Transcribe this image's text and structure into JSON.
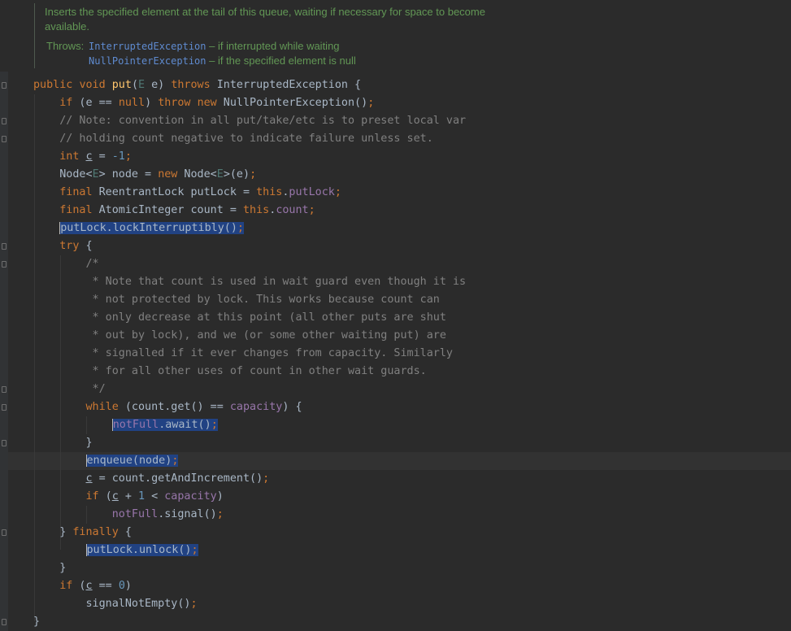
{
  "javadoc": {
    "description": "Inserts the specified element at the tail of this queue, waiting if necessary for space to become available.",
    "throws_label": "Throws:",
    "throws": [
      {
        "exception": "InterruptedException",
        "text": " – if interrupted while waiting"
      },
      {
        "exception": "NullPointerException",
        "text": " – if the specified element is null"
      }
    ]
  },
  "code": {
    "l01": {
      "a": "public",
      "b": "void",
      "c": "put",
      "d": "(",
      "e": "E",
      "f": " e) ",
      "g": "throws",
      "h": " InterruptedException {"
    },
    "l02": {
      "a": "if",
      "b": " (e == ",
      "c": "null",
      "d": ") ",
      "e": "throw",
      "f": " ",
      "g": "new",
      "h": " NullPointerException()",
      "i": ";"
    },
    "l03": "// Note: convention in all put/take/etc is to preset local var",
    "l04": "// holding count negative to indicate failure unless set.",
    "l05": {
      "a": "int",
      "b": " ",
      "c": "c",
      "d": " = ",
      "e": "-1",
      "f": ";"
    },
    "l06": {
      "a": "Node<",
      "b": "E",
      "c": "> node = ",
      "d": "new",
      "e": " Node<",
      "f": "E",
      "g": ">(e)",
      "h": ";"
    },
    "l07": {
      "a": "final",
      "b": " ReentrantLock putLock = ",
      "c": "this",
      "d": ".",
      "e": "putLock",
      "f": ";"
    },
    "l08": {
      "a": "final",
      "b": " AtomicInteger count = ",
      "c": "this",
      "d": ".",
      "e": "count",
      "f": ";"
    },
    "l09": {
      "a": "putLock.lockInterruptibly()",
      "b": ";"
    },
    "l10": {
      "a": "try",
      "b": " {"
    },
    "l11": "/*",
    "l12": " * Note that count is used in wait guard even though it is",
    "l13": " * not protected by lock. This works because count can",
    "l14": " * only decrease at this point (all other puts are shut",
    "l15": " * out by lock), and we (or some other waiting put) are",
    "l16": " * signalled if it ever changes from capacity. Similarly",
    "l17": " * for all other uses of count in other wait guards.",
    "l18": " */",
    "l19": {
      "a": "while",
      "b": " (count.get() == ",
      "c": "capacity",
      "d": ") {"
    },
    "l20": {
      "a": "notFull",
      "b": ".await()",
      "c": ";"
    },
    "l21": "}",
    "l22": {
      "a": "enqueue(node)",
      "b": ";"
    },
    "l23": {
      "a": "c",
      "b": " = count.getAndIncrement()",
      "c": ";"
    },
    "l24": {
      "a": "if",
      "b": " (",
      "c": "c",
      "d": " + ",
      "e": "1",
      "f": " < ",
      "g": "capacity",
      "h": ")"
    },
    "l25": {
      "a": "notFull",
      "b": ".signal()",
      "c": ";"
    },
    "l26": {
      "a": "} ",
      "b": "finally",
      "c": " {"
    },
    "l27": {
      "a": "putLock.unlock()",
      "b": ";"
    },
    "l28": "}",
    "l29": {
      "a": "if",
      "b": " (",
      "c": "c",
      "d": " == ",
      "e": "0",
      "f": ")"
    },
    "l30": {
      "a": "signalNotEmpty()",
      "b": ";"
    },
    "l31": "}"
  },
  "colors": {
    "background": "#2b2b2b",
    "keyword": "#cc7832",
    "method": "#ffc66d",
    "number": "#6897bb",
    "comment": "#808080",
    "field": "#9876aa",
    "type_param": "#507874",
    "doc": "#629755",
    "selection": "#214283"
  }
}
